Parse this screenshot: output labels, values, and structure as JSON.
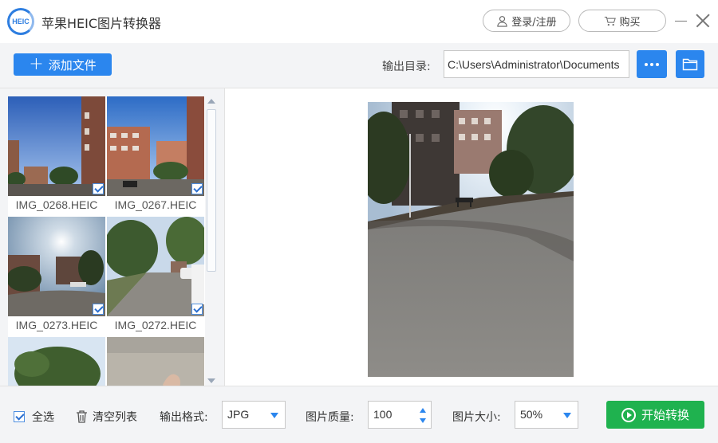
{
  "app": {
    "title": "苹果HEIC图片转换器",
    "logo_text": "HEIC",
    "login_label": "登录/注册",
    "buy_label": "购买"
  },
  "toolbar": {
    "add_label": "添加文件",
    "output_label": "输出目录:",
    "output_path": "C:\\Users\\Administrator\\Documents"
  },
  "files": [
    {
      "name": "IMG_0268.HEIC",
      "checked": true
    },
    {
      "name": "IMG_0267.HEIC",
      "checked": true
    },
    {
      "name": "IMG_0273.HEIC",
      "checked": true
    },
    {
      "name": "IMG_0272.HEIC",
      "checked": true
    },
    {
      "name": "",
      "checked": false
    },
    {
      "name": "",
      "checked": false
    }
  ],
  "bottom": {
    "select_all_label": "全选",
    "select_all_checked": true,
    "clear_label": "清空列表",
    "format_label": "输出格式:",
    "format_value": "JPG",
    "quality_label": "图片质量:",
    "quality_value": "100",
    "size_label": "图片大小:",
    "size_value": "50%",
    "start_label": "开始转换"
  },
  "colors": {
    "accent": "#2b86ee",
    "start": "#1fb24f",
    "panel_bg": "#f3f4f6"
  }
}
